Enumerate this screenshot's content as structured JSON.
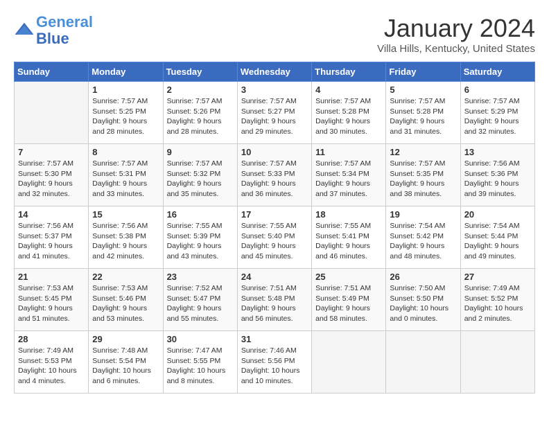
{
  "header": {
    "logo_line1": "General",
    "logo_line2": "Blue",
    "month": "January 2024",
    "location": "Villa Hills, Kentucky, United States"
  },
  "days_of_week": [
    "Sunday",
    "Monday",
    "Tuesday",
    "Wednesday",
    "Thursday",
    "Friday",
    "Saturday"
  ],
  "weeks": [
    [
      {
        "day": "",
        "sunrise": "",
        "sunset": "",
        "daylight": ""
      },
      {
        "day": "1",
        "sunrise": "Sunrise: 7:57 AM",
        "sunset": "Sunset: 5:25 PM",
        "daylight": "Daylight: 9 hours and 28 minutes."
      },
      {
        "day": "2",
        "sunrise": "Sunrise: 7:57 AM",
        "sunset": "Sunset: 5:26 PM",
        "daylight": "Daylight: 9 hours and 28 minutes."
      },
      {
        "day": "3",
        "sunrise": "Sunrise: 7:57 AM",
        "sunset": "Sunset: 5:27 PM",
        "daylight": "Daylight: 9 hours and 29 minutes."
      },
      {
        "day": "4",
        "sunrise": "Sunrise: 7:57 AM",
        "sunset": "Sunset: 5:28 PM",
        "daylight": "Daylight: 9 hours and 30 minutes."
      },
      {
        "day": "5",
        "sunrise": "Sunrise: 7:57 AM",
        "sunset": "Sunset: 5:28 PM",
        "daylight": "Daylight: 9 hours and 31 minutes."
      },
      {
        "day": "6",
        "sunrise": "Sunrise: 7:57 AM",
        "sunset": "Sunset: 5:29 PM",
        "daylight": "Daylight: 9 hours and 32 minutes."
      }
    ],
    [
      {
        "day": "7",
        "sunrise": "Sunrise: 7:57 AM",
        "sunset": "Sunset: 5:30 PM",
        "daylight": "Daylight: 9 hours and 32 minutes."
      },
      {
        "day": "8",
        "sunrise": "Sunrise: 7:57 AM",
        "sunset": "Sunset: 5:31 PM",
        "daylight": "Daylight: 9 hours and 33 minutes."
      },
      {
        "day": "9",
        "sunrise": "Sunrise: 7:57 AM",
        "sunset": "Sunset: 5:32 PM",
        "daylight": "Daylight: 9 hours and 35 minutes."
      },
      {
        "day": "10",
        "sunrise": "Sunrise: 7:57 AM",
        "sunset": "Sunset: 5:33 PM",
        "daylight": "Daylight: 9 hours and 36 minutes."
      },
      {
        "day": "11",
        "sunrise": "Sunrise: 7:57 AM",
        "sunset": "Sunset: 5:34 PM",
        "daylight": "Daylight: 9 hours and 37 minutes."
      },
      {
        "day": "12",
        "sunrise": "Sunrise: 7:57 AM",
        "sunset": "Sunset: 5:35 PM",
        "daylight": "Daylight: 9 hours and 38 minutes."
      },
      {
        "day": "13",
        "sunrise": "Sunrise: 7:56 AM",
        "sunset": "Sunset: 5:36 PM",
        "daylight": "Daylight: 9 hours and 39 minutes."
      }
    ],
    [
      {
        "day": "14",
        "sunrise": "Sunrise: 7:56 AM",
        "sunset": "Sunset: 5:37 PM",
        "daylight": "Daylight: 9 hours and 41 minutes."
      },
      {
        "day": "15",
        "sunrise": "Sunrise: 7:56 AM",
        "sunset": "Sunset: 5:38 PM",
        "daylight": "Daylight: 9 hours and 42 minutes."
      },
      {
        "day": "16",
        "sunrise": "Sunrise: 7:55 AM",
        "sunset": "Sunset: 5:39 PM",
        "daylight": "Daylight: 9 hours and 43 minutes."
      },
      {
        "day": "17",
        "sunrise": "Sunrise: 7:55 AM",
        "sunset": "Sunset: 5:40 PM",
        "daylight": "Daylight: 9 hours and 45 minutes."
      },
      {
        "day": "18",
        "sunrise": "Sunrise: 7:55 AM",
        "sunset": "Sunset: 5:41 PM",
        "daylight": "Daylight: 9 hours and 46 minutes."
      },
      {
        "day": "19",
        "sunrise": "Sunrise: 7:54 AM",
        "sunset": "Sunset: 5:42 PM",
        "daylight": "Daylight: 9 hours and 48 minutes."
      },
      {
        "day": "20",
        "sunrise": "Sunrise: 7:54 AM",
        "sunset": "Sunset: 5:44 PM",
        "daylight": "Daylight: 9 hours and 49 minutes."
      }
    ],
    [
      {
        "day": "21",
        "sunrise": "Sunrise: 7:53 AM",
        "sunset": "Sunset: 5:45 PM",
        "daylight": "Daylight: 9 hours and 51 minutes."
      },
      {
        "day": "22",
        "sunrise": "Sunrise: 7:53 AM",
        "sunset": "Sunset: 5:46 PM",
        "daylight": "Daylight: 9 hours and 53 minutes."
      },
      {
        "day": "23",
        "sunrise": "Sunrise: 7:52 AM",
        "sunset": "Sunset: 5:47 PM",
        "daylight": "Daylight: 9 hours and 55 minutes."
      },
      {
        "day": "24",
        "sunrise": "Sunrise: 7:51 AM",
        "sunset": "Sunset: 5:48 PM",
        "daylight": "Daylight: 9 hours and 56 minutes."
      },
      {
        "day": "25",
        "sunrise": "Sunrise: 7:51 AM",
        "sunset": "Sunset: 5:49 PM",
        "daylight": "Daylight: 9 hours and 58 minutes."
      },
      {
        "day": "26",
        "sunrise": "Sunrise: 7:50 AM",
        "sunset": "Sunset: 5:50 PM",
        "daylight": "Daylight: 10 hours and 0 minutes."
      },
      {
        "day": "27",
        "sunrise": "Sunrise: 7:49 AM",
        "sunset": "Sunset: 5:52 PM",
        "daylight": "Daylight: 10 hours and 2 minutes."
      }
    ],
    [
      {
        "day": "28",
        "sunrise": "Sunrise: 7:49 AM",
        "sunset": "Sunset: 5:53 PM",
        "daylight": "Daylight: 10 hours and 4 minutes."
      },
      {
        "day": "29",
        "sunrise": "Sunrise: 7:48 AM",
        "sunset": "Sunset: 5:54 PM",
        "daylight": "Daylight: 10 hours and 6 minutes."
      },
      {
        "day": "30",
        "sunrise": "Sunrise: 7:47 AM",
        "sunset": "Sunset: 5:55 PM",
        "daylight": "Daylight: 10 hours and 8 minutes."
      },
      {
        "day": "31",
        "sunrise": "Sunrise: 7:46 AM",
        "sunset": "Sunset: 5:56 PM",
        "daylight": "Daylight: 10 hours and 10 minutes."
      },
      {
        "day": "",
        "sunrise": "",
        "sunset": "",
        "daylight": ""
      },
      {
        "day": "",
        "sunrise": "",
        "sunset": "",
        "daylight": ""
      },
      {
        "day": "",
        "sunrise": "",
        "sunset": "",
        "daylight": ""
      }
    ]
  ]
}
